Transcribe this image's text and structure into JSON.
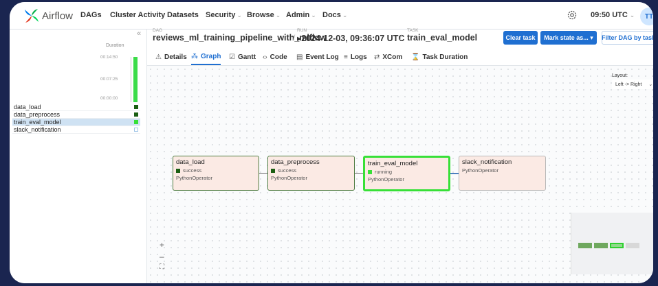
{
  "app": {
    "brand": "Airflow",
    "nav": [
      {
        "label": "DAGs",
        "caret": false
      },
      {
        "label": "Cluster Activity",
        "caret": false
      },
      {
        "label": "Datasets",
        "caret": false
      },
      {
        "label": "Security",
        "caret": true
      },
      {
        "label": "Browse",
        "caret": true
      },
      {
        "label": "Admin",
        "caret": true
      },
      {
        "label": "Docs",
        "caret": true
      }
    ],
    "caret_glyph": "⌄",
    "time": "09:50 UTC",
    "user_initials": "TT"
  },
  "breadcrumb": {
    "dag_small": "DAG",
    "dag_id": "reviews_ml_training_pipeline_with_mlflow",
    "run_small": "Run",
    "run_id": "▸2024-12-03, 09:36:07 UTC",
    "task_small": "Task",
    "task_id": "train_eval_model",
    "separator": "/"
  },
  "actions": {
    "clear_task": "Clear task",
    "mark_state": "Mark state as... ▾",
    "filter": "Filter DAG by task ▾"
  },
  "tabs": [
    {
      "icon": "⚠",
      "label": "Details",
      "active": false
    },
    {
      "icon": "⁂",
      "label": "Graph",
      "active": true
    },
    {
      "icon": "☑",
      "label": "Gantt",
      "active": false
    },
    {
      "icon": "‹›",
      "label": "Code",
      "active": false
    },
    {
      "icon": "▤",
      "label": "Event Log",
      "active": false
    },
    {
      "icon": "≡",
      "label": "Logs",
      "active": false
    },
    {
      "icon": "⇄",
      "label": "XCom",
      "active": false
    },
    {
      "icon": "⌛",
      "label": "Task Duration",
      "active": false
    }
  ],
  "grid": {
    "collapse_glyph": "«",
    "duration_label": "Duration",
    "ticks": [
      "00:14:50",
      "00:07:25",
      "00:00:00"
    ],
    "tasks": [
      {
        "name": "data_load",
        "status": "success",
        "selected": false
      },
      {
        "name": "data_preprocess",
        "status": "success",
        "selected": false
      },
      {
        "name": "train_eval_model",
        "status": "running",
        "selected": true
      },
      {
        "name": "slack_notification",
        "status": "none",
        "selected": false
      }
    ]
  },
  "layout": {
    "label": "Layout:",
    "value": "Left -> Right",
    "chevron": "⌄"
  },
  "graph": {
    "nodes": [
      {
        "name": "data_load",
        "status": "success",
        "operator": "PythonOperator"
      },
      {
        "name": "data_preprocess",
        "status": "success",
        "operator": "PythonOperator"
      },
      {
        "name": "train_eval_model",
        "status": "running",
        "operator": "PythonOperator"
      },
      {
        "name": "slack_notification",
        "status": "",
        "operator": "PythonOperator"
      }
    ]
  },
  "zoom": {
    "in": "+",
    "out": "–",
    "fit": "⛶"
  },
  "colors": {
    "success": "#1a5e12",
    "running": "#37e037",
    "accent": "#1f6fd1"
  }
}
